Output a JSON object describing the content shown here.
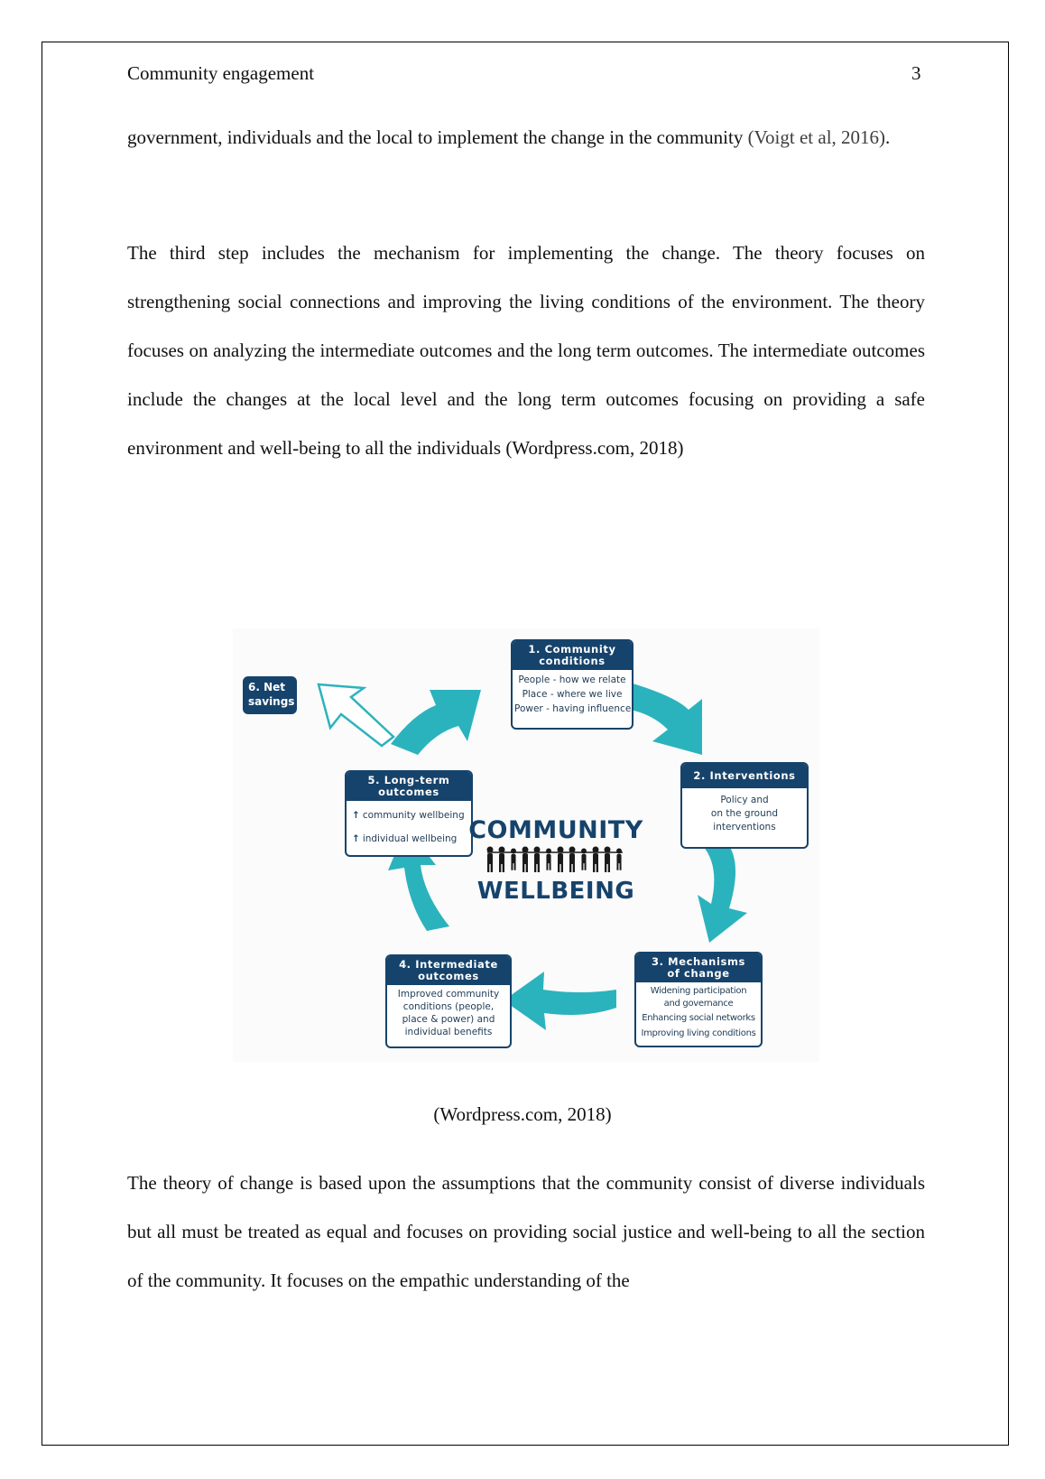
{
  "header": {
    "title": "Community engagement",
    "page_number": "3"
  },
  "paragraphs": [
    {
      "text": "government, individuals and the local to implement the change in the community ",
      "citation": "(Voigt et al, 2016)",
      "trail": "."
    },
    {
      "text": " The third step includes the mechanism for implementing the change. The theory focuses on strengthening social connections and improving the living conditions of the environment. The theory focuses on analyzing the intermediate outcomes and the long term outcomes. The intermediate outcomes include the changes at the local level and the long term outcomes focusing on providing a safe environment and well-being to all the individuals (Wordpress.com, 2018)"
    },
    {
      "text": "The theory of change is based upon the assumptions that the community consist of diverse individuals but all must be treated as equal and focuses on providing social justice and well-being to all the section of the community. It focuses on the empathic understanding of the"
    }
  ],
  "figure": {
    "center_title_top": "COMMUNITY",
    "center_title_bottom": "WELLBEING",
    "colors": {
      "navy": "#16436b",
      "teal": "#2bb3bd"
    },
    "net_savings": {
      "line1": "6. Net",
      "line2": "savings"
    },
    "boxes": {
      "community_conditions": {
        "title_line1": "1. Community",
        "title_line2": "conditions",
        "rows": [
          "People - how we relate",
          "Place - where we live",
          "Power - having influence"
        ]
      },
      "interventions": {
        "title": "2. Interventions",
        "rows": [
          "Policy and",
          "on the ground",
          "interventions"
        ]
      },
      "mechanisms": {
        "title_line1": "3. Mechanisms",
        "title_line2": "of change",
        "rows": [
          "Widening participation",
          "and governance",
          "Enhancing social networks",
          "Improving living conditions"
        ]
      },
      "intermediate": {
        "title_line1": "4. Intermediate",
        "title_line2": "outcomes",
        "rows": [
          "Improved community",
          "conditions (people,",
          "place & power) and",
          "individual benefits"
        ]
      },
      "long_term": {
        "title_line1": "5. Long-term",
        "title_line2": "outcomes",
        "rows": [
          "community wellbeing",
          "individual wellbeing"
        ]
      }
    }
  },
  "caption": "(Wordpress.com, 2018)"
}
